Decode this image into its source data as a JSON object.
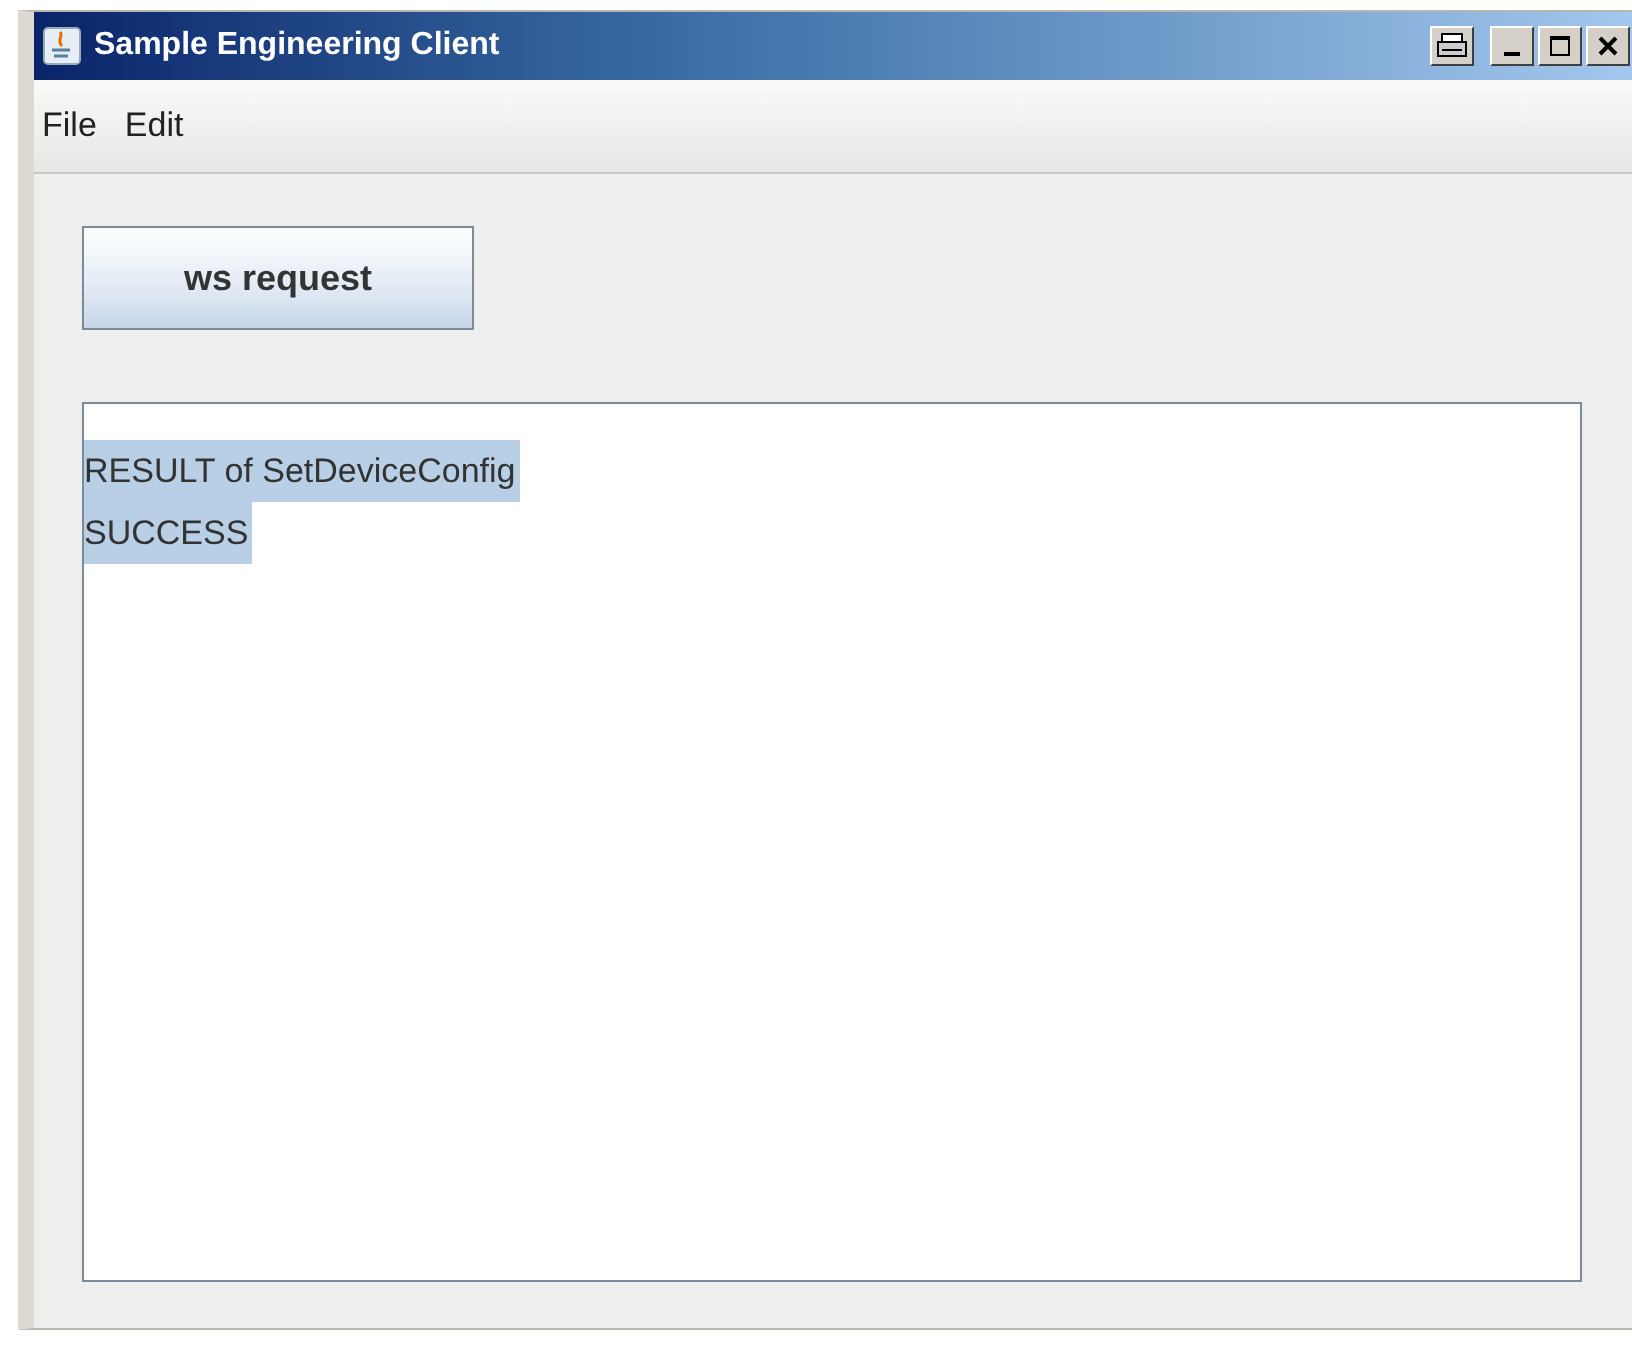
{
  "window": {
    "title": "Sample Engineering Client"
  },
  "menu": [
    {
      "label": "File"
    },
    {
      "label": "Edit"
    }
  ],
  "button": {
    "label": "ws request"
  },
  "output": {
    "lines": [
      {
        "text": "RESULT of SetDeviceConfig",
        "selected": true
      },
      {
        "text": "SUCCESS",
        "selected": true
      }
    ]
  }
}
